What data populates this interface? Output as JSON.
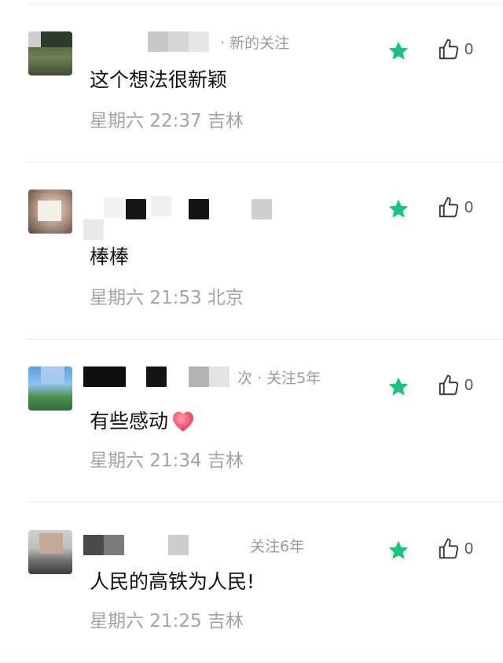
{
  "comments": [
    {
      "author_status": "· 新的关注",
      "text": "这个想法很新颖",
      "has_heart_emoji": false,
      "time": "星期六  22:37  吉林",
      "starred": true,
      "like_count": "0"
    },
    {
      "author_status": "",
      "text": "棒棒",
      "has_heart_emoji": false,
      "time": "星期六  21:53  北京",
      "starred": true,
      "like_count": "0"
    },
    {
      "author_status": "次 · 关注5年",
      "text": "有些感动",
      "has_heart_emoji": true,
      "time": "星期六  21:34  吉林",
      "starred": true,
      "like_count": "0"
    },
    {
      "author_status": "关注6年",
      "text": "人民的高铁为人民!",
      "has_heart_emoji": false,
      "time": "星期六  21:25  吉林",
      "starred": true,
      "like_count": "0"
    }
  ],
  "colors": {
    "star": "#19c37d",
    "meta_text": "#9a9a9a",
    "footer_text": "#a3a3a3",
    "heart": "#f05a74"
  },
  "icons": {
    "star": "star-icon",
    "like": "thumbs-up-icon",
    "emoji": "heart-emoji-icon"
  }
}
